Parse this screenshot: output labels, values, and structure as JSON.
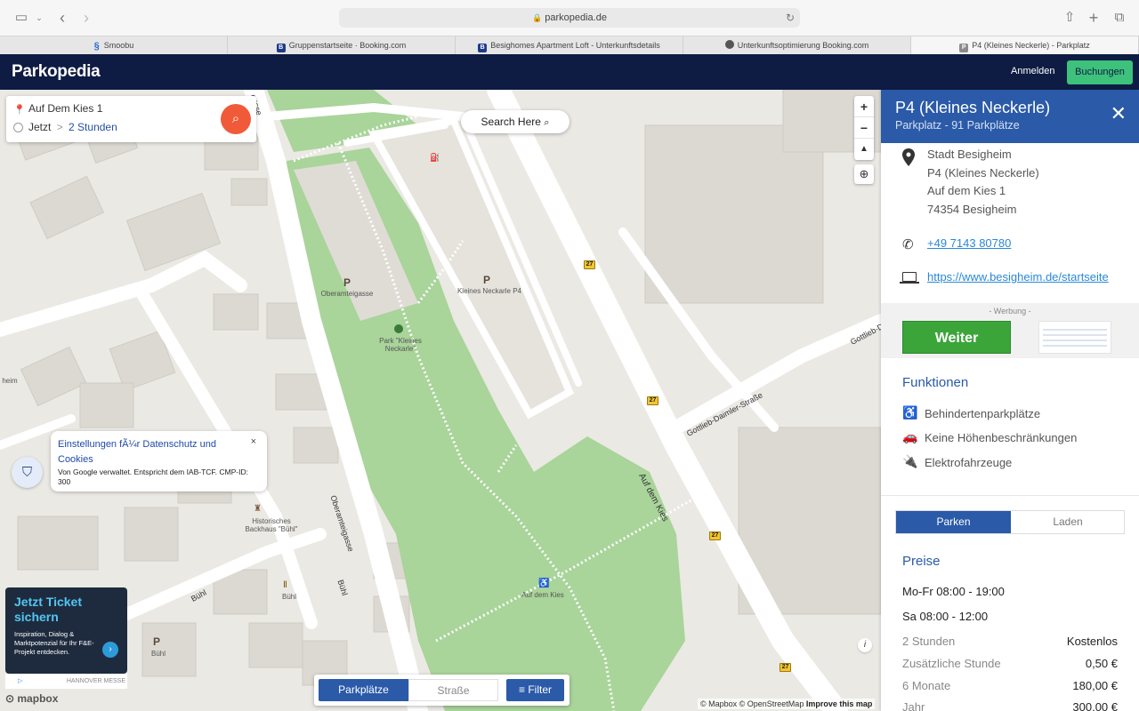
{
  "browser": {
    "url": "parkopedia.de",
    "tabs": [
      {
        "label": "Smoobu",
        "icon": "smoobu-icon"
      },
      {
        "label": "Gruppenstartseite · Booking.com",
        "icon": "booking-icon"
      },
      {
        "label": "Besighomes Apartment Loft - Unterkunftsdetails",
        "icon": "booking-icon"
      },
      {
        "label": "Unterkunftsoptimierung Booking.com",
        "icon": "globe-icon"
      },
      {
        "label": "P4 (Kleines Neckerle) - Parkplatz",
        "icon": "parkopedia-icon"
      }
    ]
  },
  "header": {
    "logo": "Parkopedia",
    "login": "Anmelden",
    "bookings": "Buchungen"
  },
  "search": {
    "address": "Auf Dem Kies 1",
    "time": "Jetzt",
    "separator": ">",
    "duration": "2 Stunden",
    "search_here": "Search Here"
  },
  "map": {
    "labels": {
      "oberamteigasse_p": "Oberamteigasse",
      "kleines_neckarle_p4": "Kleines Neckarle P4",
      "park": "Park \"Kleines\nNeckarle\"",
      "backhaus": "Historisches\nBackhaus \"Bühl\"",
      "buhl_p": "Bühl",
      "buhl_poi": "Bühl",
      "auf_dem_kies_poi": "Auf dem Kies",
      "heim": "heim"
    },
    "streets": {
      "oberamteigasse": "Oberamteigasse",
      "auf_dem_kies": "Auf dem Kies",
      "gottlieb": "Gottlieb-Daimler-Straße",
      "gottlieb2": "Gottlieb-D",
      "buhl1": "Bühl",
      "buhl2": "Bühl",
      "gasse": "gasse"
    },
    "route_number": "27",
    "p_letter": "P",
    "attribution": "© Mapbox © OpenStreetMap",
    "improve": "Improve this map",
    "mapbox": "mapbox",
    "info": "i"
  },
  "consent": {
    "title": "Einstellungen fÃ¼r Datenschutz und Cookies",
    "text": "Von Google verwaltet. Entspricht dem IAB-TCF. CMP-ID: 300",
    "close": "×"
  },
  "ad_left": {
    "headline": "Jetzt Ticket sichern",
    "body": "Inspiration, Dialog & Marktpotenzial für Ihr F&E-Projekt entdecken.",
    "footer": "HANNOVER MESSE"
  },
  "mode_bar": {
    "parking": "Parkplätze",
    "street": "Straße",
    "filter": "Filter"
  },
  "panel": {
    "title": "P4 (Kleines Neckerle)",
    "subtitle": "Parkplatz - 91 Parkplätze",
    "address": [
      "Stadt Besigheim",
      "P4 (Kleines Neckerle)",
      "Auf dem Kies 1",
      "74354 Besigheim"
    ],
    "phone": "+49 7143 80780",
    "website": "https://www.besigheim.de/startseite",
    "ad_label": "- Werbung -",
    "ad_button": "Weiter",
    "features_title": "Funktionen",
    "features": [
      {
        "label": "Behindertenparkplätze",
        "icon": "wheelchair-icon"
      },
      {
        "label": "Keine Höhenbeschränkungen",
        "icon": "car-icon"
      },
      {
        "label": "Elektrofahrzeuge",
        "icon": "plug-icon"
      }
    ],
    "tab_park": "Parken",
    "tab_charge": "Laden",
    "prices_title": "Preise",
    "hours": [
      "Mo-Fr 08:00 - 19:00",
      "Sa 08:00 - 12:00"
    ],
    "prices": [
      {
        "label": "2 Stunden",
        "value": "Kostenlos"
      },
      {
        "label": "Zusätzliche Stunde",
        "value": "0,50 €"
      },
      {
        "label": "6 Monate",
        "value": "180,00 €"
      },
      {
        "label": "Jahr",
        "value": "300,00 €"
      }
    ]
  },
  "colors": {
    "header_bg": "#0e1c43",
    "brand_blue": "#2a5aa8",
    "bookings_green": "#3dc17b",
    "search_orange": "#f05a38",
    "park_green": "#a9d49a",
    "link_blue": "#2a88d8"
  }
}
